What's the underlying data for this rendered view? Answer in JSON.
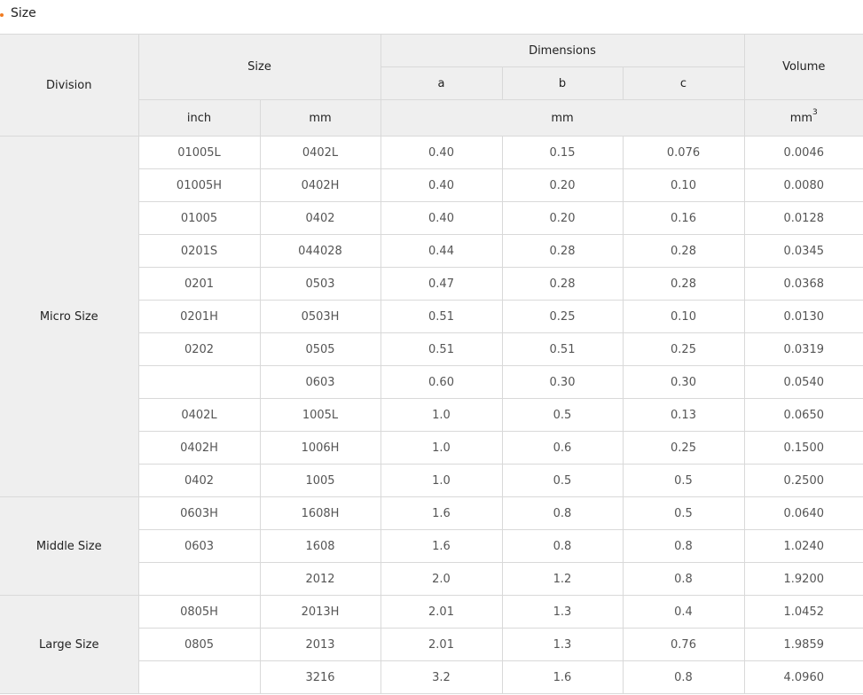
{
  "section": {
    "title": "Size"
  },
  "header": {
    "division": "Division",
    "size": "Size",
    "dimensions": "Dimensions",
    "a": "a",
    "b": "b",
    "c": "c",
    "volume": "Volume",
    "inch": "inch",
    "mm": "mm",
    "dim_unit": "mm",
    "vol_unit_base": "mm",
    "vol_unit_exp": "3"
  },
  "groups": [
    {
      "division": "Micro Size",
      "rows": [
        {
          "inch": "01005L",
          "mm": "0402L",
          "a": "0.40",
          "b": "0.15",
          "c": "0.076",
          "volume": "0.0046"
        },
        {
          "inch": "01005H",
          "mm": "0402H",
          "a": "0.40",
          "b": "0.20",
          "c": "0.10",
          "volume": "0.0080"
        },
        {
          "inch": "01005",
          "mm": "0402",
          "a": "0.40",
          "b": "0.20",
          "c": "0.16",
          "volume": "0.0128"
        },
        {
          "inch": "0201S",
          "mm": "044028",
          "a": "0.44",
          "b": "0.28",
          "c": "0.28",
          "volume": "0.0345"
        },
        {
          "inch": "0201",
          "mm": "0503",
          "a": "0.47",
          "b": "0.28",
          "c": "0.28",
          "volume": "0.0368"
        },
        {
          "inch": "0201H",
          "mm": "0503H",
          "a": "0.51",
          "b": "0.25",
          "c": "0.10",
          "volume": "0.0130"
        },
        {
          "inch": "0202",
          "mm": "0505",
          "a": "0.51",
          "b": "0.51",
          "c": "0.25",
          "volume": "0.0319"
        },
        {
          "inch": "",
          "mm": "0603",
          "a": "0.60",
          "b": "0.30",
          "c": "0.30",
          "volume": "0.0540"
        },
        {
          "inch": "0402L",
          "mm": "1005L",
          "a": "1.0",
          "b": "0.5",
          "c": "0.13",
          "volume": "0.0650"
        },
        {
          "inch": "0402H",
          "mm": "1006H",
          "a": "1.0",
          "b": "0.6",
          "c": "0.25",
          "volume": "0.1500"
        },
        {
          "inch": "0402",
          "mm": "1005",
          "a": "1.0",
          "b": "0.5",
          "c": "0.5",
          "volume": "0.2500"
        }
      ]
    },
    {
      "division": "Middle Size",
      "rows": [
        {
          "inch": "0603H",
          "mm": "1608H",
          "a": "1.6",
          "b": "0.8",
          "c": "0.5",
          "volume": "0.0640"
        },
        {
          "inch": "0603",
          "mm": "1608",
          "a": "1.6",
          "b": "0.8",
          "c": "0.8",
          "volume": "1.0240"
        },
        {
          "inch": "",
          "mm": "2012",
          "a": "2.0",
          "b": "1.2",
          "c": "0.8",
          "volume": "1.9200"
        }
      ]
    },
    {
      "division": "Large Size",
      "rows": [
        {
          "inch": "0805H",
          "mm": "2013H",
          "a": "2.01",
          "b": "1.3",
          "c": "0.4",
          "volume": "1.0452"
        },
        {
          "inch": "0805",
          "mm": "2013",
          "a": "2.01",
          "b": "1.3",
          "c": "0.76",
          "volume": "1.9859"
        },
        {
          "inch": "",
          "mm": "3216",
          "a": "3.2",
          "b": "1.6",
          "c": "0.8",
          "volume": "4.0960"
        }
      ]
    }
  ]
}
